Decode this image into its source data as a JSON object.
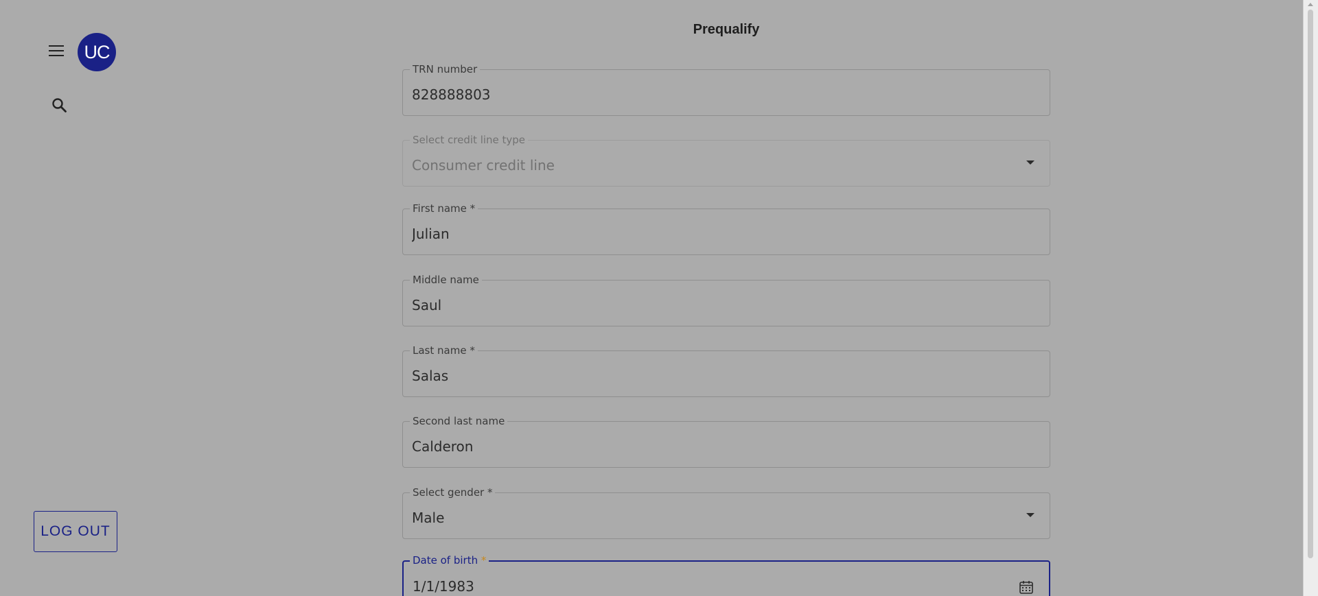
{
  "header": {
    "title": "Prequalify"
  },
  "sidebar": {
    "avatar_text": "UC",
    "logout_label": "LOG OUT"
  },
  "form": {
    "trn": {
      "label": "TRN number",
      "value": "828888803"
    },
    "credit_line": {
      "label": "Select credit line type",
      "value": "Consumer credit line"
    },
    "first_name": {
      "label": "First name *",
      "value": "Julian"
    },
    "middle_name": {
      "label": "Middle name",
      "value": "Saul"
    },
    "last_name": {
      "label": "Last name *",
      "value": "Salas"
    },
    "second_last_name": {
      "label": "Second last name",
      "value": "Calderon"
    },
    "gender": {
      "label": "Select gender *",
      "value": "Male"
    },
    "dob": {
      "label": "Date of birth",
      "required_mark": "*",
      "value": "1/1/1983"
    }
  },
  "icons": {
    "menu": "menu-icon",
    "search": "search-icon",
    "dropdown": "chevron-down-icon",
    "calendar": "calendar-icon"
  },
  "colors": {
    "accent": "#1a2186",
    "background": "#ababab",
    "required": "#c8881c"
  }
}
